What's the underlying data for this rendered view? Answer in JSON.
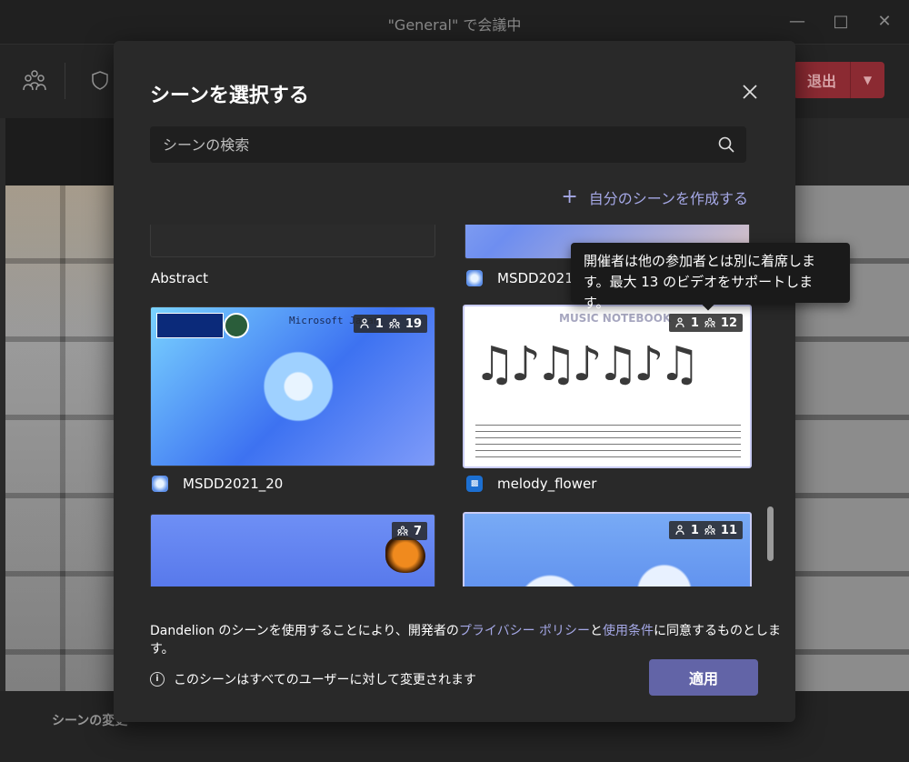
{
  "window": {
    "title": "\"General\" で会議中"
  },
  "toolbar": {
    "leave_label": "退出"
  },
  "stage": {
    "scene_change_label": "シーンの変更"
  },
  "dialog": {
    "title": "シーンを選択する",
    "search_placeholder": "シーンの検索",
    "create_label": "自分のシーンを作成する",
    "scenes": [
      {
        "name": "Abstract"
      },
      {
        "name": "MSDD2021_"
      },
      {
        "name": "MSDD2021_20",
        "organizers": "1",
        "participants": "19",
        "overlay_text": "Microsoft Japan"
      },
      {
        "name": "melody_flower",
        "organizers": "1",
        "participants": "12",
        "overlay_text": "MUSIC NOTEBOOK"
      },
      {
        "participants": "7"
      },
      {
        "organizers": "1",
        "participants": "11"
      }
    ],
    "tooltip": "開催者は他の参加者とは別に着席します。最大 13 のビデオをサポートします。",
    "consent": {
      "prefix": "Dandelion のシーンを使用することにより、開発者の",
      "privacy_link": "プライバシー ポリシー",
      "middle": "と",
      "terms_link": "使用条件",
      "suffix": "に同意するものとします。"
    },
    "info_text": "このシーンはすべてのユーザーに対して変更されます",
    "apply_label": "適用"
  },
  "colors": {
    "accent": "#6264a7",
    "link": "#a5a8e6",
    "leave": "#8b2a32"
  }
}
